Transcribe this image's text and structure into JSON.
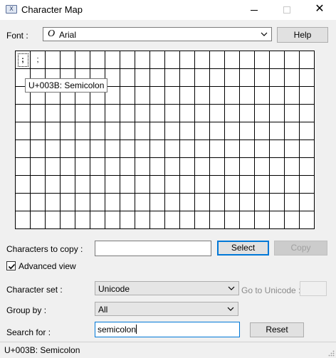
{
  "window": {
    "title": "Character Map",
    "icon": "character-map-app-icon",
    "controls": [
      "minimize",
      "maximize",
      "close"
    ]
  },
  "font": {
    "label": "Font :",
    "value": "Arial",
    "icon": "opentype-o-icon"
  },
  "help_label": "Help",
  "grid": {
    "selected_char": ";",
    "second_char": ";",
    "tooltip": "U+003B: Semicolon"
  },
  "characters_to_copy": {
    "label": "Characters to copy :",
    "value": ""
  },
  "select_label": "Select",
  "copy_label": "Copy",
  "advanced_view": {
    "label": "Advanced view",
    "checked": true
  },
  "character_set": {
    "label": "Character set :",
    "value": "Unicode"
  },
  "go_to_unicode": {
    "label": "Go to Unicode :",
    "value": ""
  },
  "group_by": {
    "label": "Group by :",
    "value": "All"
  },
  "search": {
    "label": "Search for :",
    "value": "semicolon"
  },
  "reset_label": "Reset",
  "status_text": "U+003B: Semicolon"
}
